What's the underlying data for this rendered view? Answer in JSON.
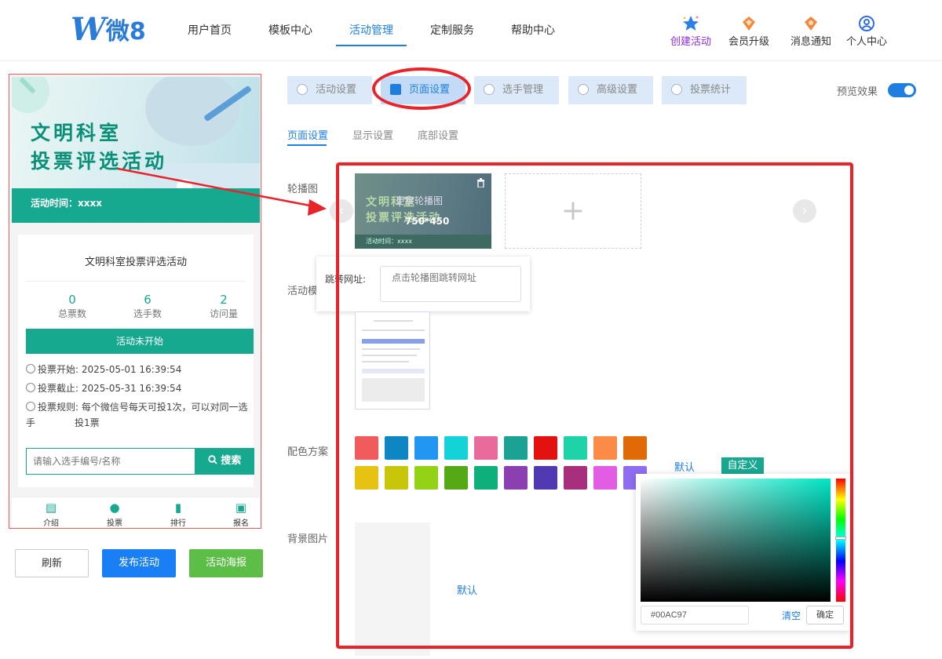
{
  "header": {
    "logo_w": "W",
    "logo_text": "微8",
    "nav": [
      "用户首页",
      "模板中心",
      "活动管理",
      "定制服务",
      "帮助中心"
    ],
    "active_nav": "活动管理",
    "tools": [
      {
        "label": "创建活动",
        "icon": "star-icon"
      },
      {
        "label": "会员升级",
        "icon": "diamond-icon"
      },
      {
        "label": "消息通知",
        "icon": "bell-icon"
      },
      {
        "label": "个人中心",
        "icon": "user-icon"
      }
    ]
  },
  "phone": {
    "banner_title_1": "文明科室",
    "banner_title_2": "投票评选活动",
    "banner_time": "活动时间：xxxx",
    "activity_name": "文明科室投票评选活动",
    "stats": [
      {
        "value": "0",
        "label": "总票数"
      },
      {
        "value": "6",
        "label": "选手数"
      },
      {
        "value": "2",
        "label": "访问量"
      }
    ],
    "status": "活动未开始",
    "vote_start_label": "投票开始:",
    "vote_start": "2025-05-01 16:39:54",
    "vote_end_label": "投票截止:",
    "vote_end": "2025-05-31 16:39:54",
    "rule_label": "投票规则:",
    "rule_text_1": "每个微信号每天可投1次，可以对同一选手",
    "rule_text_2": "投1票",
    "search_placeholder": "请输入选手编号/名称",
    "search_button": "搜索",
    "bottom_nav": [
      "介绍",
      "投票",
      "排行",
      "报名"
    ]
  },
  "actions": {
    "refresh": "刷新",
    "publish": "发布活动",
    "poster": "活动海报"
  },
  "tabs": [
    "活动设置",
    "页面设置",
    "选手管理",
    "高级设置",
    "投票统计"
  ],
  "active_tab": "页面设置",
  "preview_label": "预览效果",
  "preview_on": true,
  "subtabs": [
    "页面设置",
    "显示设置",
    "底部设置"
  ],
  "active_subtab": "页面设置",
  "form": {
    "carousel_label": "轮播图",
    "carousel_thumb_title_1": "文明科室",
    "carousel_thumb_title_2": "投票评选活动",
    "carousel_thumb_overlay": "更换轮播图",
    "carousel_thumb_size": "750*450",
    "carousel_thumb_time": "活动时间：xxxx",
    "add_symbol": "+",
    "jump_label": "跳转网址:",
    "jump_placeholder": "点击轮播图跳转网址",
    "template_label": "活动模",
    "color_label": "配色方案",
    "mode_default": "默认",
    "mode_custom": "自定义",
    "bg_label": "背景图片",
    "bg_default": "默认"
  },
  "swatches": [
    "#f25b5b",
    "#0e86c4",
    "#2196f3",
    "#13d3d8",
    "#e96b9c",
    "#1aa394",
    "#e41111",
    "#1fd3a8",
    "#fb8b47",
    "#e06a06",
    "#e8c211",
    "#c8c60a",
    "#94d215",
    "#55a915",
    "#0faf7c",
    "#8b3fb0",
    "#5239b4",
    "#a82f7e",
    "#e25de3",
    "#8f6df0"
  ],
  "picker": {
    "hex": "#00AC97",
    "clear": "清空",
    "ok": "确定"
  },
  "colors": {
    "accent": "#1f7fe0",
    "theme": "#17a890",
    "annotation": "#e8232a"
  }
}
